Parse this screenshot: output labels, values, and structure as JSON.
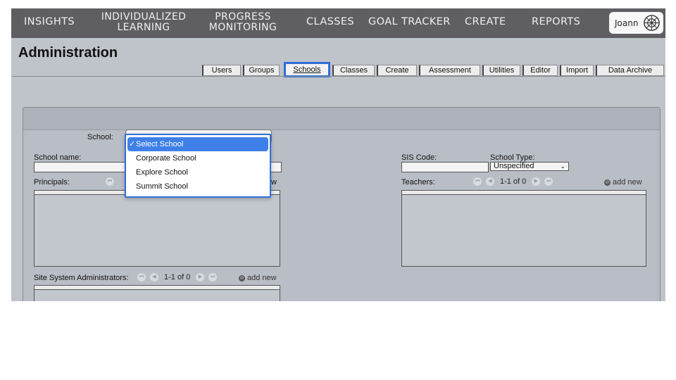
{
  "nav": {
    "insights": "INSIGHTS",
    "individualized_line1": "INDIVIDUALIZED",
    "individualized_line2": "LEARNING",
    "progress_line1": "PROGRESS",
    "progress_line2": "MONITORING",
    "classes": "CLASSES",
    "goal_tracker": "GOAL TRACKER",
    "create": "CREATE",
    "reports": "REPORTS",
    "user_name": "Joann"
  },
  "page": {
    "title": "Administration"
  },
  "tabs": [
    "Users",
    "Groups",
    "Schools",
    "Classes",
    "Create",
    "Assessment",
    "Utilities",
    "Editor",
    "Import",
    "Data Archive"
  ],
  "active_tab": "Schools",
  "form": {
    "school_label": "School:",
    "school_name_label": "School name:",
    "principals_label": "Principals:",
    "sis_code_label": "SIS Code:",
    "school_type_label": "School Type:",
    "school_type_value": "Unspecified",
    "teachers_label": "Teachers:",
    "teachers_count": "1-1 of 0",
    "teachers_add": "add new",
    "principals_add_partial": "w",
    "site_admins_label": "Site System Administrators:",
    "site_admins_count": "1-1 of 0",
    "site_admins_add": "add new"
  },
  "dropdown": {
    "options": [
      "Select School",
      "Corporate School",
      "Explore School",
      "Summit School"
    ],
    "selected": "Select School"
  },
  "colors": {
    "nav_bg": "#5e5e63",
    "page_bg": "#bfc3ca",
    "accent": "#2f6fd6",
    "selected_option": "#3f80e8"
  }
}
